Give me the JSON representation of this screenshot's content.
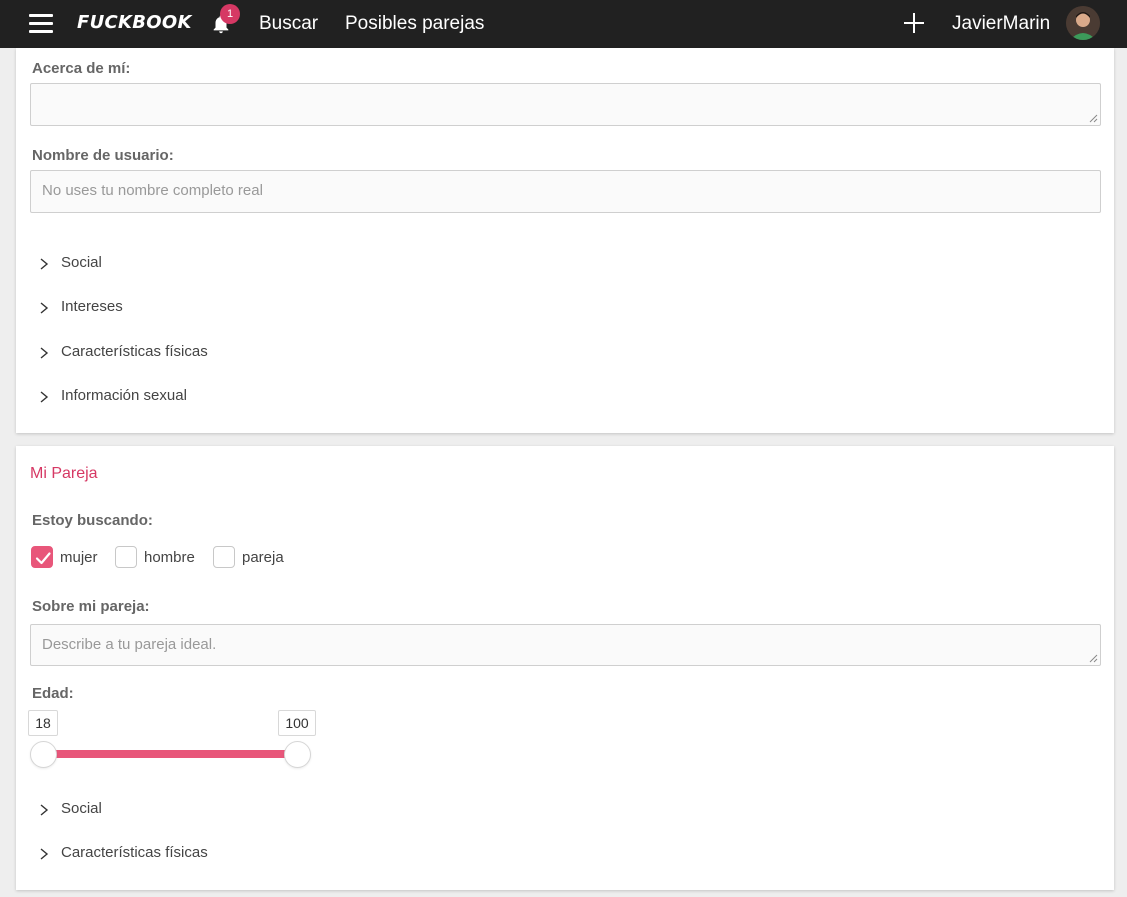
{
  "navbar": {
    "logo": "FUCKBOOK",
    "notification_count": "1",
    "links": [
      "Buscar",
      "Posibles parejas"
    ],
    "username": "JavierMarin"
  },
  "profile": {
    "about_label": "Acerca de mí:",
    "about_value": "",
    "username_label": "Nombre de usuario:",
    "username_placeholder": "No uses tu nombre completo real",
    "sections": [
      "Social",
      "Intereses",
      "Características físicas",
      "Información sexual"
    ]
  },
  "partner": {
    "title": "Mi Pareja",
    "looking_label": "Estoy buscando:",
    "options": [
      {
        "label": "mujer",
        "checked": true
      },
      {
        "label": "hombre",
        "checked": false
      },
      {
        "label": "pareja",
        "checked": false
      }
    ],
    "about_label": "Sobre mi pareja:",
    "about_placeholder": "Describe a tu pareja ideal.",
    "age_label": "Edad:",
    "age_min": "18",
    "age_max": "100",
    "sections": [
      "Social",
      "Características físicas"
    ]
  },
  "colors": {
    "accent": "#e8567a",
    "title_accent": "#d63864",
    "navbar": "#212121"
  }
}
